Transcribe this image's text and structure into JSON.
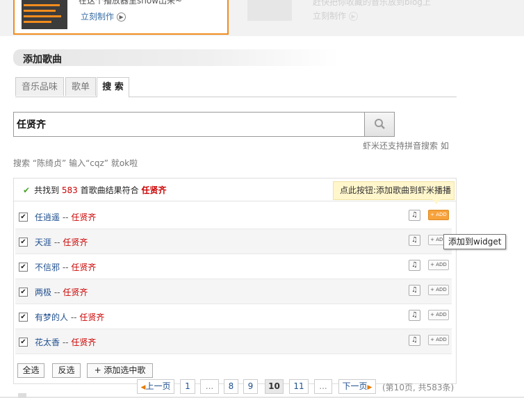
{
  "promo": {
    "text1": "在这个播放器里show出来~",
    "link1": "立刻制作",
    "text2": "赶快把你收藏的音乐放到blog上",
    "link2": "立刻制作"
  },
  "section_title": "添加歌曲",
  "tabs": [
    "音乐品味",
    "歌单",
    "搜 索"
  ],
  "search": {
    "query": "任贤齐",
    "hint_part1": "虾米还支持拼音搜索 如",
    "hint_part2": "搜索 “陈绮贞” 输入“cqz” 就ok啦"
  },
  "results": {
    "prefix": "共找到",
    "count": "583",
    "middle": "首歌曲结果符合",
    "artist": "任贤齐",
    "add_hint": "点此按钮:添加歌曲到虾米播播",
    "widget_tooltip": "添加到widget",
    "add_label": "+ ADD",
    "listen_icon": "headphones-icon",
    "rows": [
      {
        "title": "任逍遥",
        "sep": " -- ",
        "singer": "任贤齐",
        "checked": true
      },
      {
        "title": "天涯",
        "sep": " -- ",
        "singer": "任贤齐",
        "checked": true
      },
      {
        "title": "不信邪",
        "sep": " -- ",
        "singer": "任贤齐",
        "checked": true
      },
      {
        "title": "两极",
        "sep": " -- ",
        "singer": "任贤齐",
        "checked": true
      },
      {
        "title": "有梦的人",
        "sep": " -- ",
        "singer": "任贤齐",
        "checked": true
      },
      {
        "title": "花太香",
        "sep": " -- ",
        "singer": "任贤齐",
        "checked": true
      }
    ]
  },
  "actions": {
    "select_all": "全选",
    "invert": "反选",
    "add_selected": "+ 添加选中歌"
  },
  "pagination": {
    "prev": "上一页",
    "pages": [
      "1",
      "...",
      "8",
      "9",
      "10",
      "11",
      "..."
    ],
    "current": "10",
    "next": "下一页",
    "summary": "(第10页, 共583条)"
  },
  "colors": {
    "accent_orange": "#f28c1d",
    "link_blue": "#1f4f8f",
    "artist_red": "#cc0000",
    "hint_yellow": "#fff6cc"
  }
}
